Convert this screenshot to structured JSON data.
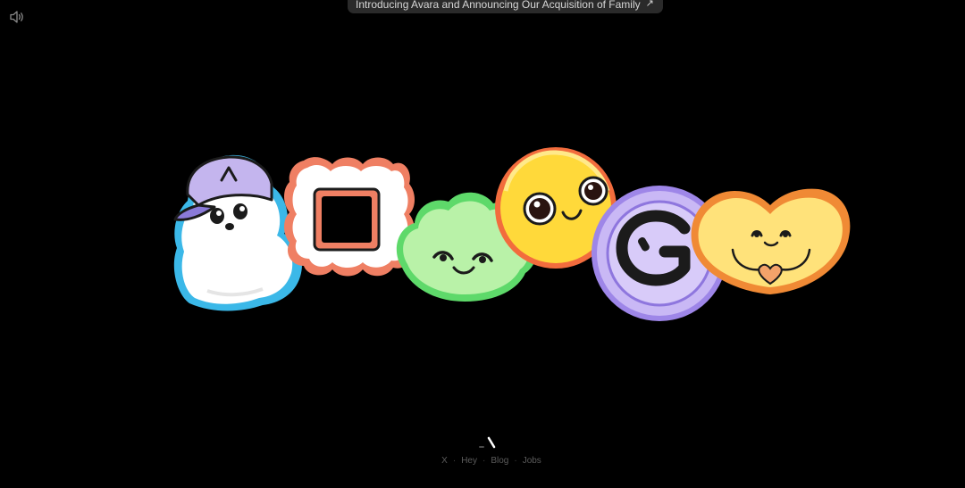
{
  "announcement": {
    "text": "Introducing Avara and Announcing Our Acquisition of Family",
    "arrow": "↗"
  },
  "sound_toggle": {
    "icon": "speaker-icon"
  },
  "stickers": [
    {
      "name": "ghost-cap",
      "icon": "ghost-sticker-icon",
      "cap_letter": "Λ"
    },
    {
      "name": "square-cookie",
      "icon": "square-frame-sticker-icon"
    },
    {
      "name": "green-cloud",
      "icon": "cloud-sticker-icon"
    },
    {
      "name": "yellow-face",
      "icon": "smiley-sticker-icon"
    },
    {
      "name": "purple-coin",
      "icon": "coin-sticker-icon"
    },
    {
      "name": "yellow-heart",
      "icon": "heart-sticker-icon"
    }
  ],
  "footer": {
    "logo": "avara-logo-icon",
    "links": [
      "X",
      "Hey",
      "Blog",
      "Jobs"
    ],
    "separator": "·"
  },
  "colors": {
    "background": "#000000",
    "ghost_outline": "#3bb8e8",
    "cap": "#c4b5ee",
    "cookie_outline": "#ef7f63",
    "cloud": "#b9f2a8",
    "cloud_outline": "#5ed96a",
    "sun": "#ffd93a",
    "sun_outline": "#f26c3d",
    "coin": "#c9b8f5",
    "coin_outline": "#9e86e8",
    "heart": "#ffe27a",
    "heart_outline": "#f08a35"
  }
}
